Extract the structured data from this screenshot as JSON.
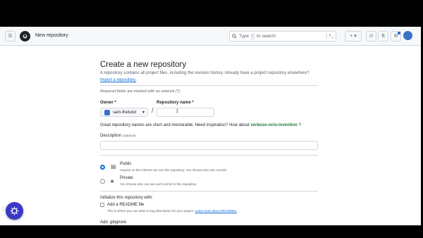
{
  "header": {
    "breadcrumb": "New repository",
    "search": {
      "prefix": "Type",
      "key": "/",
      "suffix": "to search"
    }
  },
  "page": {
    "title": "Create a new repository",
    "subtitle": "A repository contains all project files, including the revision history. Already have a project repository elsewhere?",
    "import_link": "Import a repository.",
    "required_note": "Required fields are marked with an asterisk (*)."
  },
  "form": {
    "owner_label": "Owner *",
    "owner_value": "sam-thetutor",
    "repo_label": "Repository name *",
    "repo_value": "",
    "hint_prefix": "Great repository names are short and memorable. Need inspiration? How about",
    "hint_suggestion": "verbose-octo-invention",
    "hint_suffix": "?",
    "description_label": "Description",
    "description_optional": "(optional)",
    "description_value": ""
  },
  "visibility": {
    "selected": "public",
    "public_title": "Public",
    "public_desc": "Anyone on the internet can see this repository. You choose who can commit.",
    "private_title": "Private",
    "private_desc": "You choose who can see and commit to this repository."
  },
  "init": {
    "label": "Initialize this repository with:",
    "readme_label": "Add a README file",
    "readme_desc": "This is where you can write a long description for your project.",
    "readme_link": "Learn more about READMEs.",
    "gitignore_label": "Add .gitignore"
  },
  "colors": {
    "accent": "#0969da",
    "widget": "#3a39c8",
    "suggestion": "#1a7f37"
  }
}
